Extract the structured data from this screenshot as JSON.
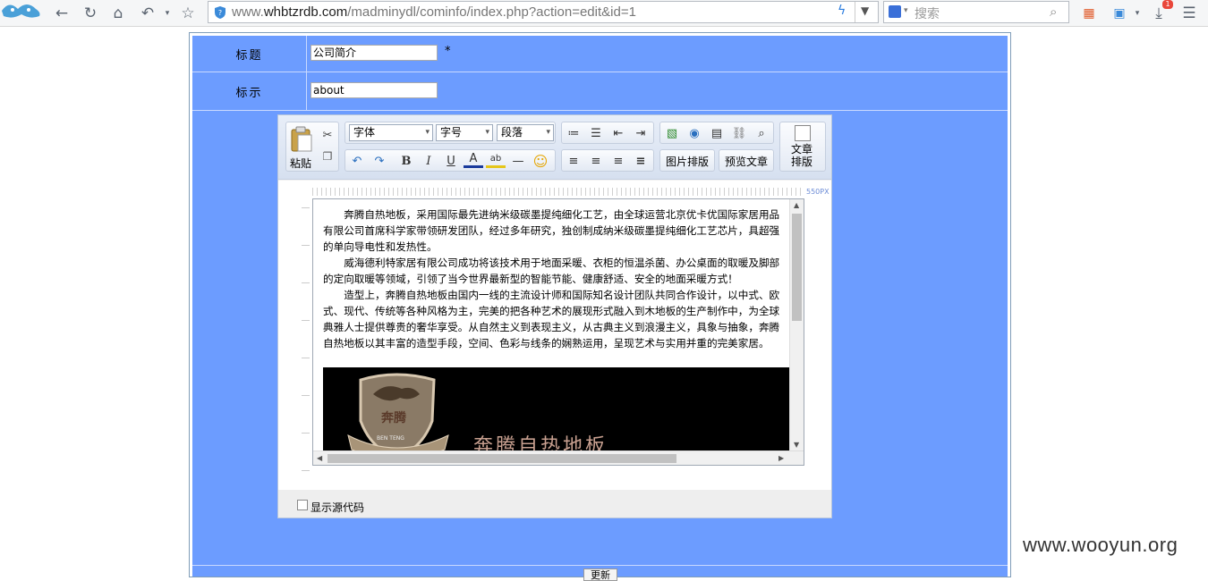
{
  "browser": {
    "url_prefix": "www.",
    "url_domain": "whbtzrdb.com",
    "url_path": "/madminydl/cominfo/index.php?action=edit&id=1",
    "search_placeholder": "搜索",
    "download_badge": "1"
  },
  "form": {
    "title_label": "标题",
    "title_value": "公司简介",
    "required_mark": "*",
    "tag_label": "标示",
    "tag_value": "about"
  },
  "editor": {
    "paste_label": "粘贴",
    "font_select": "字体",
    "size_select": "字号",
    "paragraph_select": "段落",
    "image_layout_button": "图片排版",
    "preview_button": "预览文章",
    "article_layout_line1": "文章",
    "article_layout_line2": "排版",
    "ruler_label": "550PX",
    "paragraphs": [
      "奔腾自热地板，采用国际最先进纳米级碳墨提纯细化工艺，由全球运营北京优卡优国际家居用品有限公司首席科学家带领研发团队，经过多年研究，独创制成纳米级碳墨提纯细化工艺芯片，具超强的单向导电性和发热性。",
      "威海德利特家居有限公司成功将该技术用于地面采暖、衣柜的恒温杀菌、办公桌面的取暖及脚部的定向取暖等领域，引领了当今世界最新型的智能节能、健康舒适、安全的地面采暖方式！",
      "造型上，奔腾自热地板由国内一线的主流设计师和国际知名设计团队共同合作设计，以中式、欧式、现代、传统等各种风格为主，完美的把各种艺术的展现形式融入到木地板的生产制作中，为全球典雅人士提供尊贵的奢华享受。从自然主义到表现主义，从古典主义到浪漫主义，具象与抽象，奔腾自热地板以其丰富的造型手段，空间、色彩与线条的娴熟运用，呈现艺术与实用并重的完美家居。"
    ],
    "logo_text": "奔腾",
    "logo_subtext": "BEN TENG",
    "banner_text": "奔腾自热地板",
    "show_source_label": "显示源代码"
  },
  "submit_label": "更新",
  "watermark": "www.wooyun.org"
}
